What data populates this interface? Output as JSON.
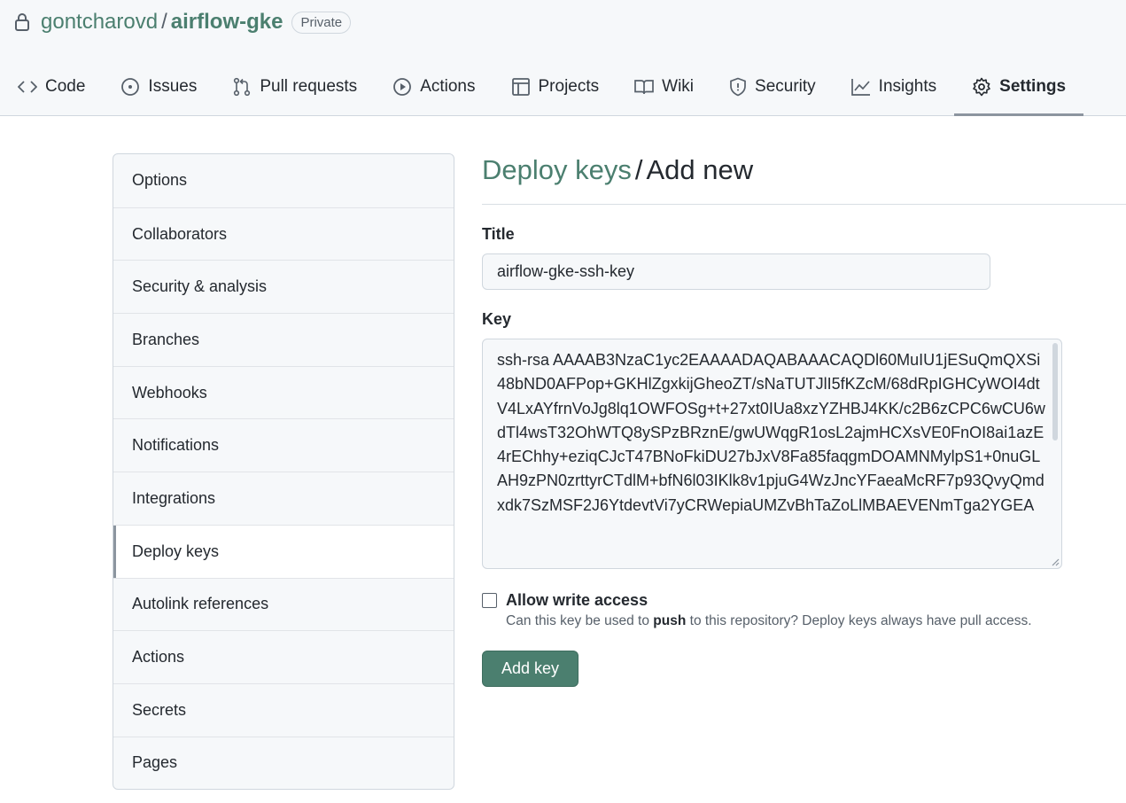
{
  "repo": {
    "owner": "gontcharovd",
    "separator": "/",
    "name": "airflow-gke",
    "visibility": "Private",
    "lock_icon": "lock-icon"
  },
  "tabs": [
    {
      "label": "Code",
      "icon": "code-icon"
    },
    {
      "label": "Issues",
      "icon": "issue-opened-icon"
    },
    {
      "label": "Pull requests",
      "icon": "git-pull-request-icon"
    },
    {
      "label": "Actions",
      "icon": "play-icon"
    },
    {
      "label": "Projects",
      "icon": "table-icon"
    },
    {
      "label": "Wiki",
      "icon": "book-icon"
    },
    {
      "label": "Security",
      "icon": "shield-icon"
    },
    {
      "label": "Insights",
      "icon": "graph-icon"
    },
    {
      "label": "Settings",
      "icon": "gear-icon",
      "active": true
    }
  ],
  "sidebar": {
    "items": [
      {
        "label": "Options"
      },
      {
        "label": "Collaborators"
      },
      {
        "label": "Security & analysis"
      },
      {
        "label": "Branches"
      },
      {
        "label": "Webhooks"
      },
      {
        "label": "Notifications"
      },
      {
        "label": "Integrations"
      },
      {
        "label": "Deploy keys",
        "active": true
      },
      {
        "label": "Autolink references"
      },
      {
        "label": "Actions"
      },
      {
        "label": "Secrets"
      },
      {
        "label": "Pages"
      }
    ]
  },
  "main": {
    "breadcrumb": "Deploy keys",
    "separator": "/",
    "title": "Add new",
    "title_label": "Title",
    "title_value": "airflow-gke-ssh-key",
    "key_label": "Key",
    "key_value": "ssh-rsa AAAAB3NzaC1yc2EAAAADAQABAAACAQDl60MuIU1jESuQmQXSi48bND0AFPop+GKHlZgxkijGheoZT/sNaTUTJlI5fKZcM/68dRpIGHCyWOI4dtV4LxAYfrnVoJg8lq1OWFOSg+t+27xt0IUa8xzYZHBJ4KK/c2B6zCPC6wCU6wdTl4wsT32OhWTQ8ySPzBRznE/gwUWqgR1osL2ajmHCXsVE0FnOI8ai1azE4rEChhy+eziqCJcT47BNoFkiDU27bJxV8Fa85faqgmDOAMNMylpS1+0nuGLAH9zPN0zrttyrCTdlM+bfN6l03IKlk8v1pjuG4WzJncYFaeaMcRF7p93QvyQmdxdk7SzMSF2J6YtdevtVi7yCRWepiaUMZvBhTaZoLlMBAEVENmTga2YGEA",
    "write_access_label": "Allow write access",
    "write_access_checked": false,
    "write_access_note_before": "Can this key be used to ",
    "write_access_note_bold": "push",
    "write_access_note_after": " to this repository? Deploy keys always have pull access.",
    "submit_label": "Add key"
  },
  "colors": {
    "accent": "#4b7f6f",
    "header_bg": "#f6f8fa",
    "border": "#d0d7de"
  }
}
